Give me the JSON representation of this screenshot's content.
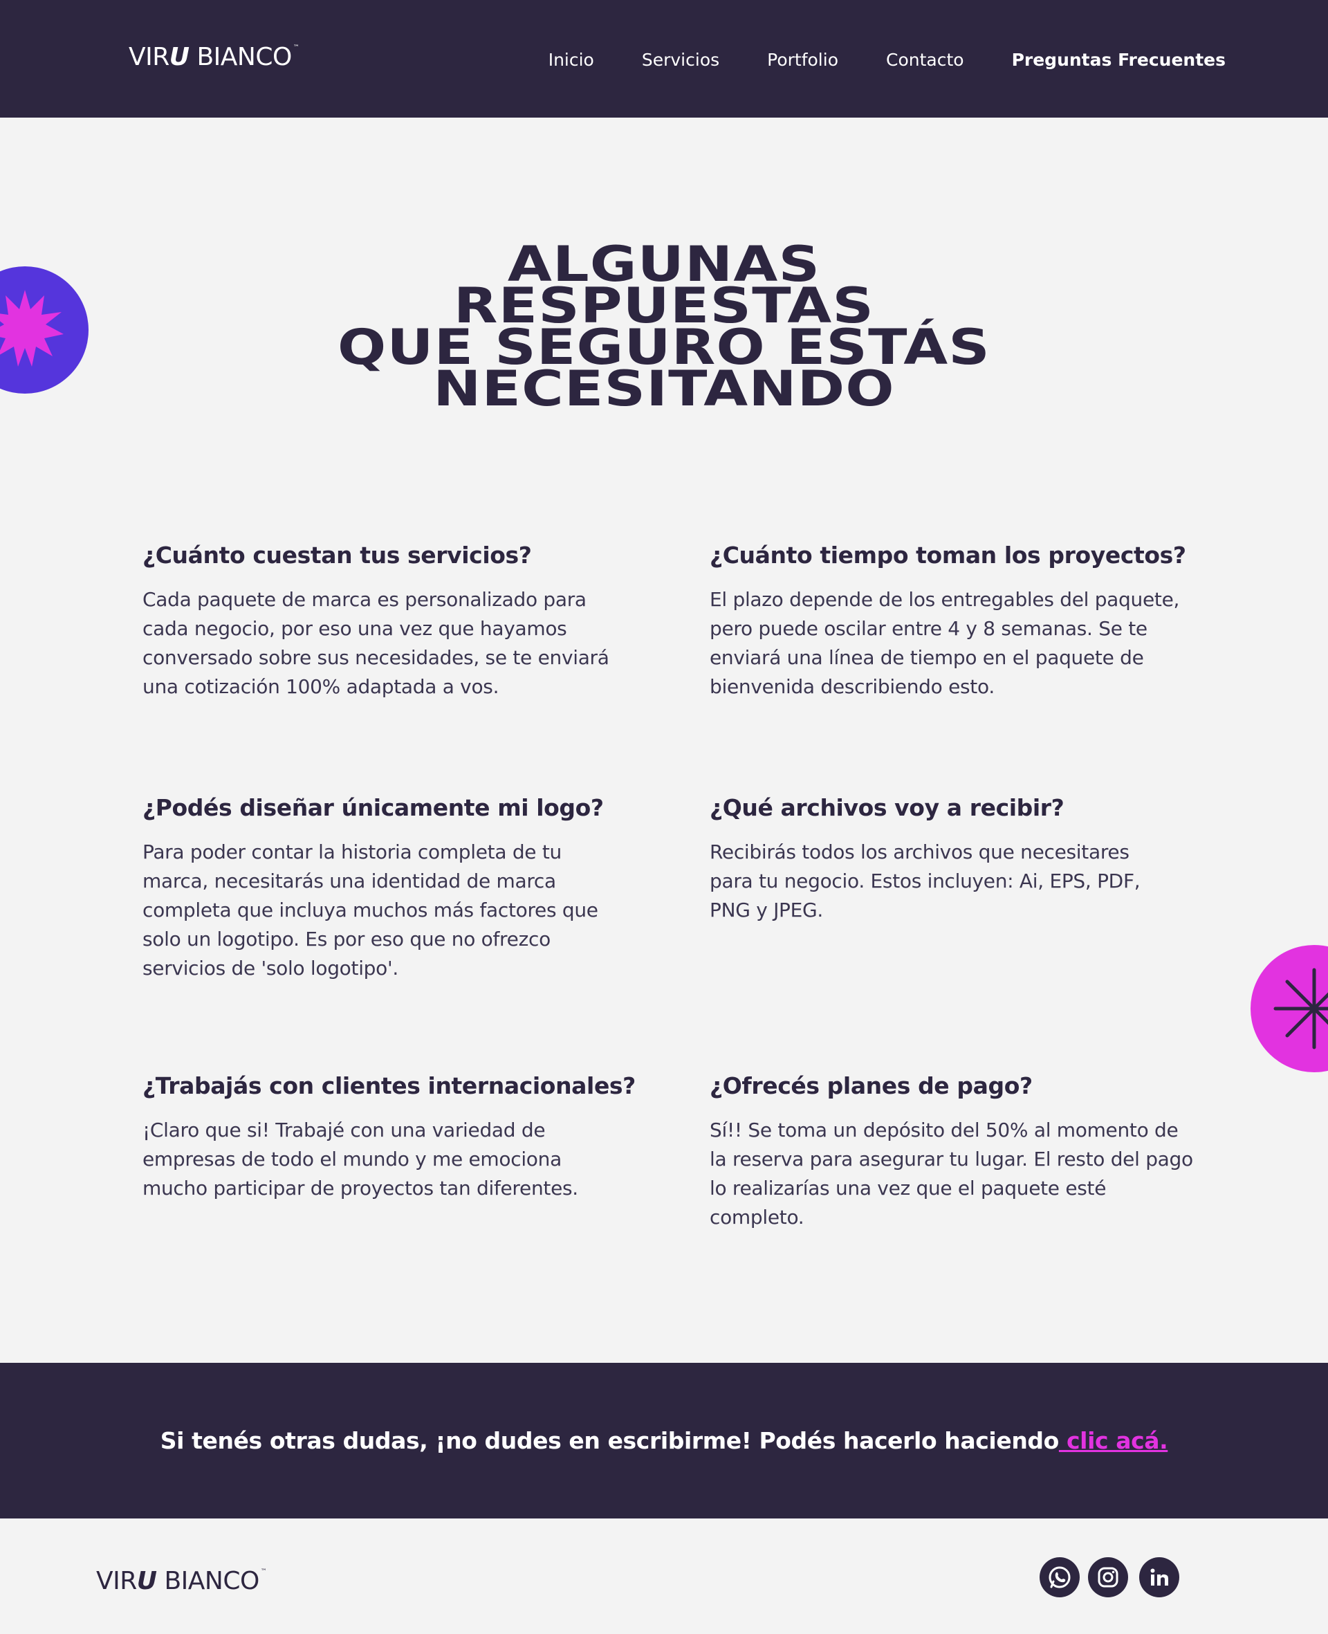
{
  "brand": {
    "logo_main": "VIR",
    "logo_u": "U",
    "logo_rest": " BIANCO",
    "logo_tm": "™"
  },
  "nav": {
    "items": [
      "Inicio",
      "Servicios",
      "Portfolio",
      "Contacto",
      "Preguntas Frecuentes"
    ],
    "active": "Preguntas Frecuentes"
  },
  "hero": {
    "lines": [
      "ALGUNAS",
      "RESPUESTAS",
      "QUE SEGURO ESTÁS",
      "NECESITANDO"
    ]
  },
  "faq": [
    {
      "question": "¿Cuánto cuestan tus servicios?",
      "answer": "Cada paquete de marca es personalizado para cada negocio, por eso una vez que hayamos conversado sobre sus necesidades, se te enviará una cotización 100% adaptada a vos."
    },
    {
      "question": "¿Cuánto tiempo toman los proyectos?",
      "answer": "El plazo depende de los entregables del paquete, pero puede oscilar entre 4 y 8 semanas. Se te enviará una línea de tiempo en el paquete de bienvenida describiendo esto."
    },
    {
      "question": "¿Podés diseñar únicamente mi logo?",
      "answer": "Para poder contar la historia completa de tu marca, necesitarás una identidad de marca completa que incluya muchos más factores que solo un logotipo. Es por eso que no ofrezco servicios de 'solo logotipo'."
    },
    {
      "question": "¿Qué archivos voy a recibir?",
      "answer": "Recibirás todos los archivos que necesitares para tu negocio. Estos incluyen: Ai, EPS, PDF, PNG y JPEG."
    },
    {
      "question": "¿Trabajás con clientes internacionales?",
      "answer": "¡Claro que si! Trabajé con una variedad de empresas de todo el mundo y me emociona mucho participar de proyectos tan diferentes."
    },
    {
      "question": "¿Ofrecés planes de pago?",
      "answer": "Sí!! Se toma un depósito del 50% al momento de la reserva para asegurar tu lugar. El resto del pago lo realizarías una vez que el paquete esté completo."
    }
  ],
  "cta": {
    "text": "Si tenés otras dudas, ¡no dudes en escribirme! Podés hacerlo haciendo",
    "link_label": " clic acá."
  },
  "footer": {
    "social": [
      "whatsapp-icon",
      "instagram-icon",
      "linkedin-icon"
    ]
  },
  "colors": {
    "navy": "#2d2640",
    "magenta": "#e233e0",
    "violet": "#5535dc",
    "background": "#f3f3f3"
  }
}
